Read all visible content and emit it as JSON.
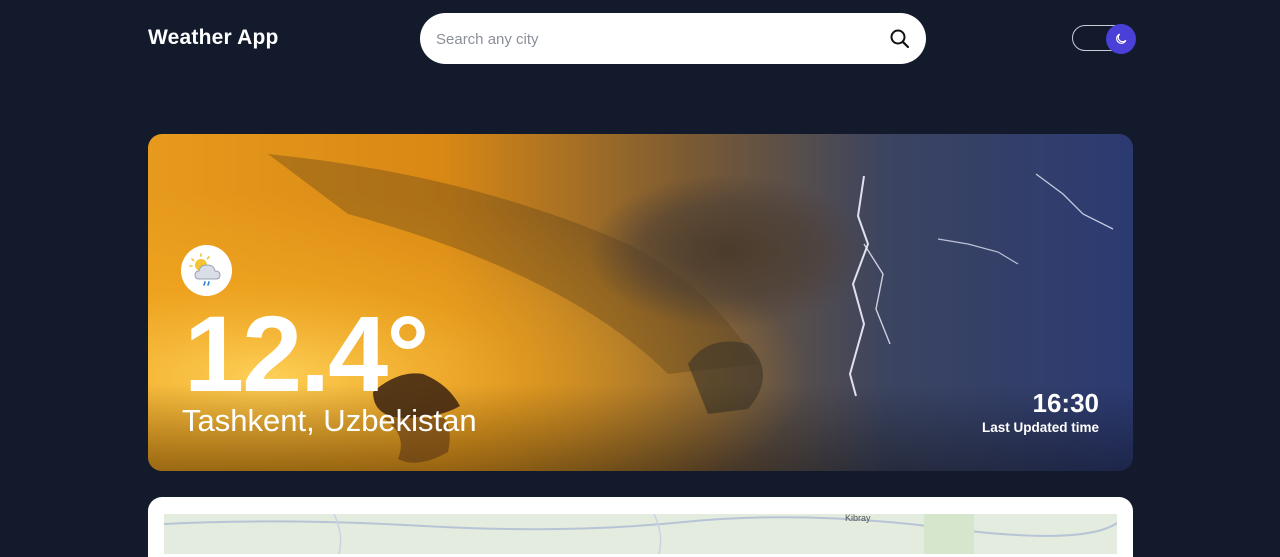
{
  "header": {
    "app_title": "Weather App",
    "search": {
      "placeholder": "Search any city",
      "value": ""
    },
    "theme_toggle": {
      "mode": "dark",
      "icon": "moon-icon",
      "accent_color": "#4a3fd6"
    }
  },
  "current_weather": {
    "icon": "cloud-sun-rain-icon",
    "temperature": "12.4°",
    "location": "Tashkent, Uzbekistan",
    "time": "16:30",
    "time_label": "Last Updated time"
  },
  "map": {
    "visible_label": "Kibray"
  },
  "colors": {
    "background": "#131a2c",
    "card": "#ffffff",
    "accent": "#4a3fd6"
  }
}
